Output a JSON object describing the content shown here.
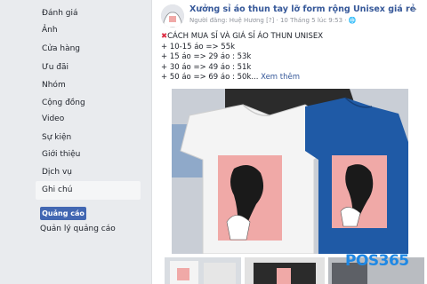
{
  "sidebar": {
    "items": [
      {
        "label": "Đánh giá"
      },
      {
        "label": "Ảnh"
      },
      {
        "label": "Cửa hàng"
      },
      {
        "label": "Ưu đãi"
      },
      {
        "label": "Nhóm"
      },
      {
        "label": "Cộng đồng"
      },
      {
        "label": "Video"
      },
      {
        "label": "Sự kiện"
      },
      {
        "label": "Giới thiệu"
      },
      {
        "label": "Dịch vụ"
      },
      {
        "label": "Ghi chú",
        "active": true
      }
    ],
    "ad_button": "Quảng cáo",
    "ad_manage": "Quản lý quảng cáo"
  },
  "post": {
    "title": "Xưởng sỉ áo thun tay lỡ form rộng Unisex giá rẻ",
    "meta": "Người đăng: Huệ Hương  [?]  · 10 Tháng 5 lúc 9:53 · 🌐",
    "heading": "CÁCH MUA SỈ VÀ GIÁ SỈ ÁO THUN UNISEX",
    "lines": [
      "+ 10-15 áo => 55k",
      "+ 15 áo => 29 áo : 53k",
      "+ 30 áo => 49 áo : 51k",
      "+ 50 áo => 69 áo : 50k..."
    ],
    "see_more": "Xem thêm",
    "dots": "···"
  },
  "watermark": {
    "text": "POS365",
    "color": "#1e88e5"
  },
  "colors": {
    "brand": "#4267b2",
    "link": "#365899",
    "pink": "#f0a9a7"
  }
}
